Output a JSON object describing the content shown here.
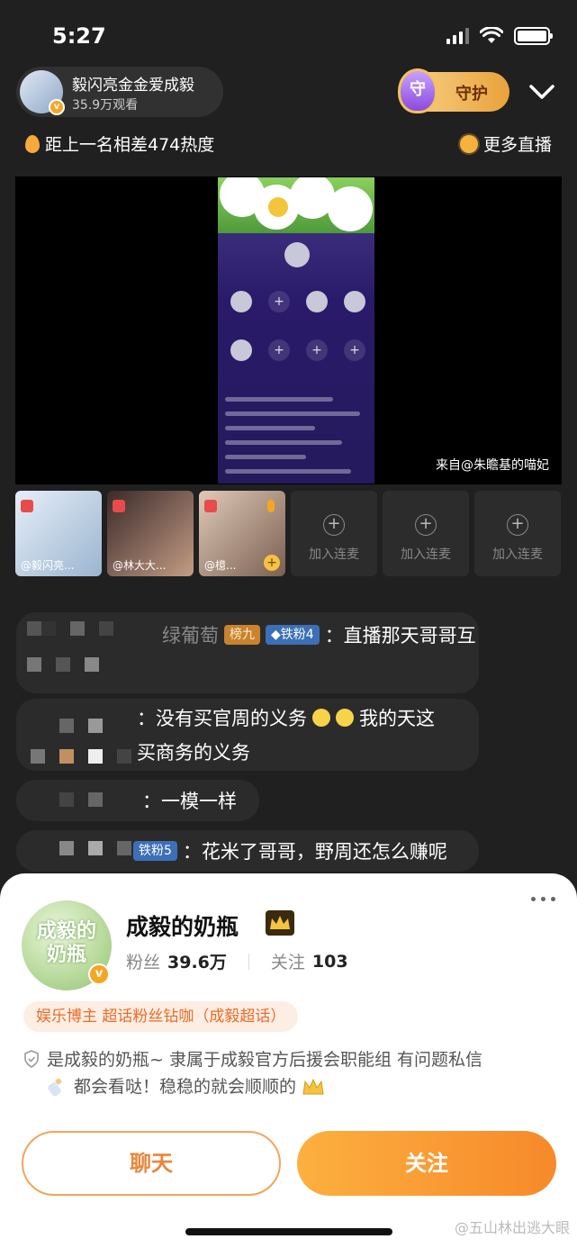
{
  "status": {
    "time": "5:27"
  },
  "anchor": {
    "name": "毅闪亮金金爱成毅",
    "views": "35.9万观看",
    "verify_mark": "v"
  },
  "guard": {
    "shield_char": "守",
    "label": "守护"
  },
  "rank": {
    "diff_text": "距上一名相差474热度"
  },
  "more_live": {
    "label": "更多直播"
  },
  "video": {
    "source_text": "来自@朱瞻基的喵妃"
  },
  "mic_slots": [
    {
      "name": "@毅闪亮..."
    },
    {
      "name": "@林大大..."
    },
    {
      "name": "@檍..."
    },
    {
      "join_label": "加入连麦"
    },
    {
      "join_label": "加入连麦"
    },
    {
      "join_label": "加入连麦"
    }
  ],
  "comments": [
    {
      "user": "绿葡萄",
      "rank_badge": "榜九",
      "fan_badge": "◆铁粉4",
      "text": "：直播那天哥哥互"
    },
    {
      "text_line1": "：没有买官周的义务",
      "text_line1_b": "我的天这",
      "text_line2": "买商务的义务"
    },
    {
      "text": "：一模一样"
    },
    {
      "fan_badge": "铁粉5",
      "text": "：花米了哥哥，野周还怎么赚呢"
    }
  ],
  "profile": {
    "avatar_text": "成毅的奶瓶",
    "name": "成毅的奶瓶",
    "fans_label": "粉丝",
    "fans_value": "39.6万",
    "follow_label": "关注",
    "follow_value": "103",
    "tags": "娱乐博主  超话粉丝钻咖（成毅超话）",
    "bio_line1": "是成毅的奶瓶~ 隶属于成毅官方后援会职能组  有问题私信",
    "bio_line2": "都会看哒！稳稳的就会顺顺的",
    "chat_label": "聊天",
    "follow_button_label": "关注"
  },
  "watermark": "@五山林出逃大眼",
  "colors": {
    "accent": "#f7892a",
    "background": "#202020",
    "sheet": "#ffffff"
  }
}
